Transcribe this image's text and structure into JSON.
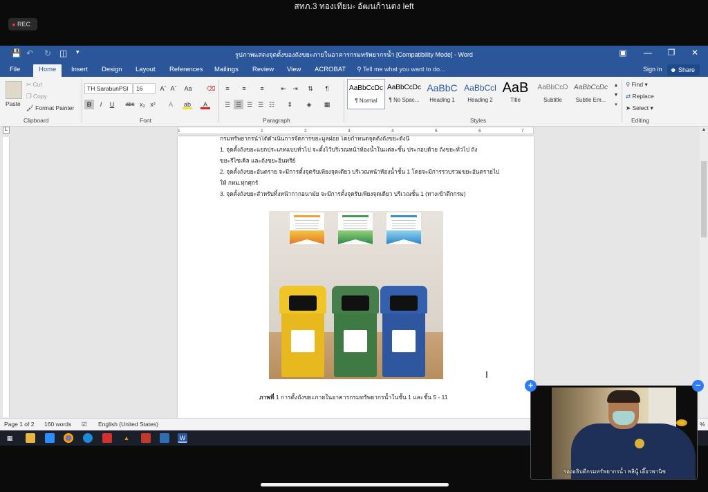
{
  "meeting": {
    "title": "สทภ.3 ทองเทียม⸗ อัฒนก้านตง left",
    "rec_label": "REC"
  },
  "word": {
    "doc_title": "รูปภาพแสดงจุดตั้งของถังขยะภายในอาคารกรมทรัพยากรน้ำ [Compatibility Mode] - Word",
    "tabs": [
      "File",
      "Home",
      "Insert",
      "Design",
      "Layout",
      "References",
      "Mailings",
      "Review",
      "View",
      "ACROBAT"
    ],
    "active_tab": "Home",
    "tell_me": "Tell me what you want to do...",
    "sign_in": "Sign in",
    "share": "Share",
    "clipboard": {
      "paste": "Paste",
      "cut": "Cut",
      "copy": "Copy",
      "format_painter": "Format Painter",
      "group": "Clipboard"
    },
    "font": {
      "name": "TH SarabunPSI",
      "size": "16",
      "group": "Font"
    },
    "paragraph": {
      "group": "Paragraph"
    },
    "styles": {
      "group": "Styles",
      "items": [
        {
          "sample": "AaBbCcDc",
          "name": "¶ Normal"
        },
        {
          "sample": "AaBbCcDc",
          "name": "¶ No Spac..."
        },
        {
          "sample": "AaBbC",
          "name": "Heading 1"
        },
        {
          "sample": "AaBbCcl",
          "name": "Heading 2"
        },
        {
          "sample": "AaB",
          "name": "Title"
        },
        {
          "sample": "AaBbCcD",
          "name": "Subtitle"
        },
        {
          "sample": "AaBbCcDc",
          "name": "Subtle Em..."
        }
      ]
    },
    "editing": {
      "group": "Editing",
      "find": "Find",
      "replace": "Replace",
      "select": "Select"
    },
    "ruler_ticks": [
      "1",
      "1",
      "2",
      "3",
      "4",
      "5",
      "6",
      "7"
    ],
    "page_lines": [
      "กรมทรัพยากรน้ำได้ดำเนินการจัดการขยะมูลฝอย โดยกำหนดจุดตั้งถังขยะดังนี้",
      "1. จุดตั้งถังขยะแยกประเภทแบบทั่วไป จะตั้งไว้บริเวณหน้าห้องน้ำในแต่ละชั้น ประกอบด้วย ถังขยะทั่วไป ถัง",
      "ขยะรีไซเคิล และถังขยะอินทรีย์",
      "2. จุดตั้งถังขยะอันตราย จะมีการตั้งจุดรับเพียงจุดเดียว บริเวณหน้าห้องน้ำชั้น 1 โดยจะมีการรวบรวมขยะอันตรายไป",
      "ให้ กทม.ทุกศุกร์",
      "3. จุดตั้งถังขยะสำหรับทิ้งหน้ากากอนามัย จะมีการตั้งจุดรับเพียงจุดเดียว บริเวณชั้น 1 (ทางเข้าตึกกรม)"
    ],
    "caption_bold": "ภาพที่",
    "caption_rest": " 1 การตั้งถังขยะภายในอาคารกรมทรัพยากรน้ำในชั้น 1 และชั้น 5 - 11",
    "status": {
      "page": "Page 1 of 2",
      "words": "160 words",
      "language": "English (United States)",
      "zoom_fragment": "%"
    }
  },
  "video": {
    "participant_name": "รองอธิบดีกรมทรัพยากรน้ำ พลินู้ เอี๊ยวพานิช"
  },
  "colors": {
    "word_blue": "#2b579a",
    "bin_yellow": "#e8b81f",
    "bin_green": "#3f7a45",
    "bin_blue": "#2f57a0",
    "accent_button": "#2e7df6"
  }
}
